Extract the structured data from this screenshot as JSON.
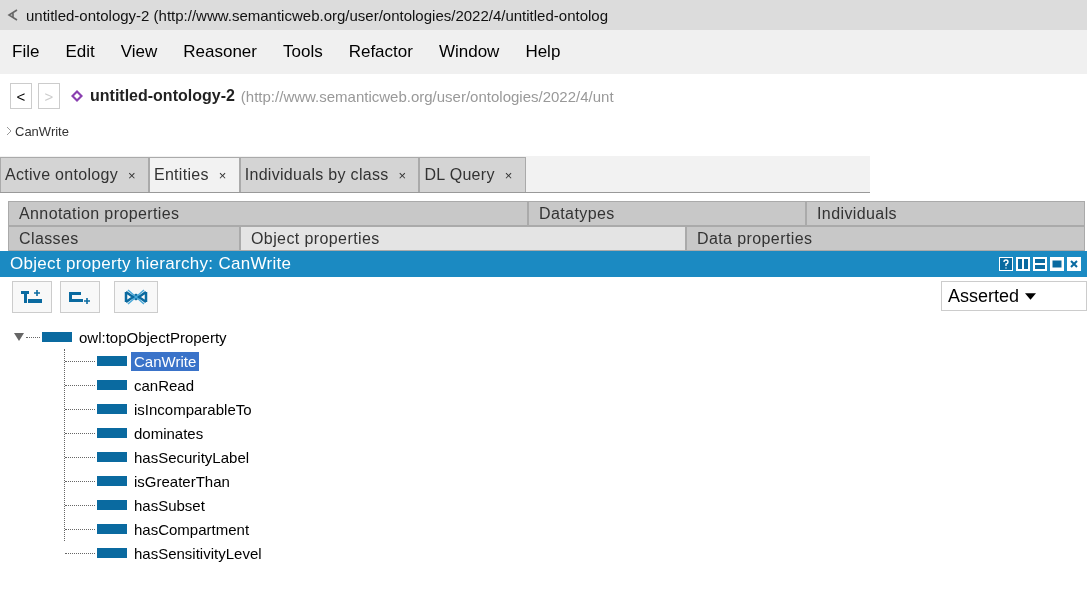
{
  "window": {
    "title": "untitled-ontology-2 (http://www.semanticweb.org/user/ontologies/2022/4/untitled-ontolog"
  },
  "menu": [
    "File",
    "Edit",
    "View",
    "Reasoner",
    "Tools",
    "Refactor",
    "Window",
    "Help"
  ],
  "nav": {
    "back": "<",
    "forward": ">",
    "back_disabled": false,
    "forward_disabled": true,
    "ontology": "untitled-ontology-2",
    "iri": "(http://www.semanticweb.org/user/ontologies/2022/4/unt"
  },
  "breadcrumb": "CanWrite",
  "tabs": [
    {
      "label": "Active ontology",
      "close": "×",
      "selected": false
    },
    {
      "label": "Entities",
      "close": "×",
      "selected": true
    },
    {
      "label": "Individuals by class",
      "close": "×",
      "selected": false
    },
    {
      "label": "DL Query",
      "close": "×",
      "selected": false
    }
  ],
  "entity_tabs": [
    [
      {
        "label": "Annotation properties",
        "selected": false
      },
      {
        "label": "Datatypes",
        "selected": false
      },
      {
        "label": "Individuals",
        "selected": false
      }
    ],
    [
      {
        "label": "Classes",
        "selected": false
      },
      {
        "label": "Object properties",
        "selected": true
      },
      {
        "label": "Data properties",
        "selected": false
      }
    ]
  ],
  "panel": {
    "title": "Object property hierarchy: CanWrite",
    "view_mode": "Asserted"
  },
  "tree": [
    {
      "label": "owl:topObjectProperty",
      "selected": false,
      "expanded": true,
      "children": [
        {
          "label": "CanWrite",
          "selected": true
        },
        {
          "label": "canRead",
          "selected": false
        },
        {
          "label": "isIncomparableTo",
          "selected": false
        },
        {
          "label": "dominates",
          "selected": false
        },
        {
          "label": "hasSecurityLabel",
          "selected": false
        },
        {
          "label": "isGreaterThan",
          "selected": false
        },
        {
          "label": "hasSubset",
          "selected": false
        },
        {
          "label": "hasCompartment",
          "selected": false
        },
        {
          "label": "hasSensitivityLevel",
          "selected": false
        }
      ]
    }
  ]
}
